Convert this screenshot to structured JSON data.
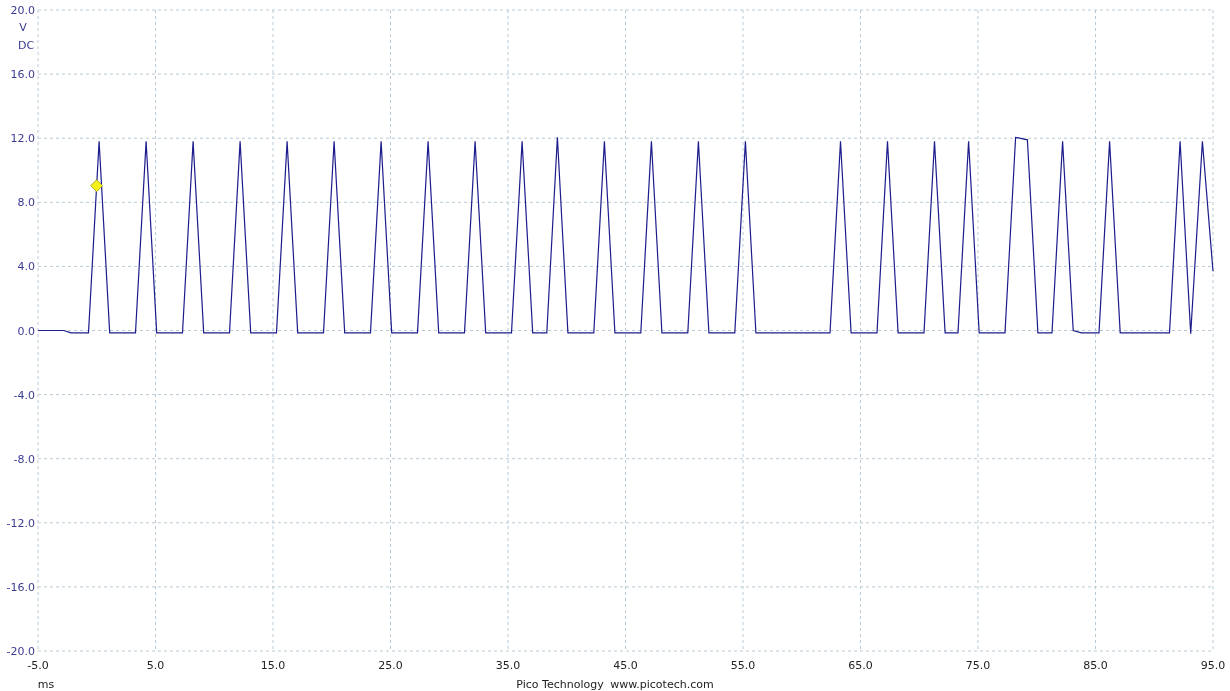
{
  "scope_view": {
    "coupling_label": "DC",
    "chart_data": {
      "type": "line",
      "grid": true,
      "xlabel": "ms",
      "ylabel": "V",
      "xlim": [
        -5,
        95
      ],
      "ylim": [
        -20,
        20
      ],
      "xticks": [
        {
          "value": -5,
          "label": "-5.0"
        },
        {
          "value": 5,
          "label": "5.0"
        },
        {
          "value": 15,
          "label": "15.0"
        },
        {
          "value": 25,
          "label": "25.0"
        },
        {
          "value": 35,
          "label": "35.0"
        },
        {
          "value": 45,
          "label": "45.0"
        },
        {
          "value": 55,
          "label": "55.0"
        },
        {
          "value": 65,
          "label": "65.0"
        },
        {
          "value": 75,
          "label": "75.0"
        },
        {
          "value": 85,
          "label": "85.0"
        },
        {
          "value": 95,
          "label": "95.0"
        }
      ],
      "yticks": [
        {
          "value": 20,
          "label": "20.0"
        },
        {
          "value": 16,
          "label": "16.0"
        },
        {
          "value": 12,
          "label": "12.0"
        },
        {
          "value": 8,
          "label": "8.0"
        },
        {
          "value": 4,
          "label": "4.0"
        },
        {
          "value": 0,
          "label": "0.0"
        },
        {
          "value": -4,
          "label": "-4.0"
        },
        {
          "value": -8,
          "label": "-8.0"
        },
        {
          "value": -12,
          "label": "-12.0"
        },
        {
          "value": -16,
          "label": "-16.0"
        },
        {
          "value": -20,
          "label": "-20.0"
        }
      ],
      "x": [
        -5,
        -2.8,
        -2.2,
        -0.7,
        0.2,
        1.1,
        3.3,
        4.2,
        5.1,
        7.3,
        8.2,
        9.1,
        11.3,
        12.2,
        13.1,
        15.3,
        16.2,
        17.1,
        19.3,
        20.2,
        21.1,
        23.3,
        24.2,
        25.1,
        27.3,
        28.2,
        29.1,
        31.3,
        32.2,
        33.1,
        35.3,
        36.2,
        37.1,
        38.3,
        39.2,
        40.1,
        42.3,
        43.2,
        44.1,
        46.3,
        47.2,
        48.1,
        50.3,
        51.2,
        52.1,
        54.3,
        55.2,
        56.1,
        62.4,
        63.3,
        64.2,
        66.4,
        67.3,
        68.2,
        70.4,
        71.3,
        72.2,
        73.3,
        74.2,
        75.1,
        77.3,
        78.2,
        79.2,
        80.1,
        81.3,
        82.2,
        83.1,
        83.8,
        85.3,
        86.2,
        87.1,
        91.3,
        92.2,
        93.1,
        94.1,
        95
      ],
      "series": [
        {
          "color": "#1c1c8c",
          "values": [
            0,
            0,
            -0.15,
            -0.15,
            11.8,
            -0.15,
            -0.15,
            11.8,
            -0.15,
            -0.15,
            11.8,
            -0.15,
            -0.15,
            11.8,
            -0.15,
            -0.15,
            11.8,
            -0.15,
            -0.15,
            11.8,
            -0.15,
            -0.15,
            11.8,
            -0.15,
            -0.15,
            11.8,
            -0.15,
            -0.15,
            11.8,
            -0.15,
            -0.15,
            11.8,
            -0.15,
            -0.15,
            12.05,
            -0.15,
            -0.15,
            11.8,
            -0.15,
            -0.15,
            11.8,
            -0.15,
            -0.15,
            11.8,
            -0.15,
            -0.15,
            11.8,
            -0.15,
            -0.15,
            11.8,
            -0.15,
            -0.15,
            11.8,
            -0.15,
            -0.15,
            11.8,
            -0.15,
            -0.15,
            11.8,
            -0.15,
            -0.15,
            12.05,
            11.9,
            -0.15,
            -0.15,
            11.8,
            0,
            -0.15,
            -0.15,
            11.8,
            -0.15,
            -0.15,
            11.8,
            -0.2,
            11.8,
            3.7
          ]
        }
      ],
      "data_labels": false
    },
    "trigger_marker": {
      "visible": true
    }
  },
  "footer": {
    "company": "Pico Technology",
    "website": "www.picotech.com"
  }
}
